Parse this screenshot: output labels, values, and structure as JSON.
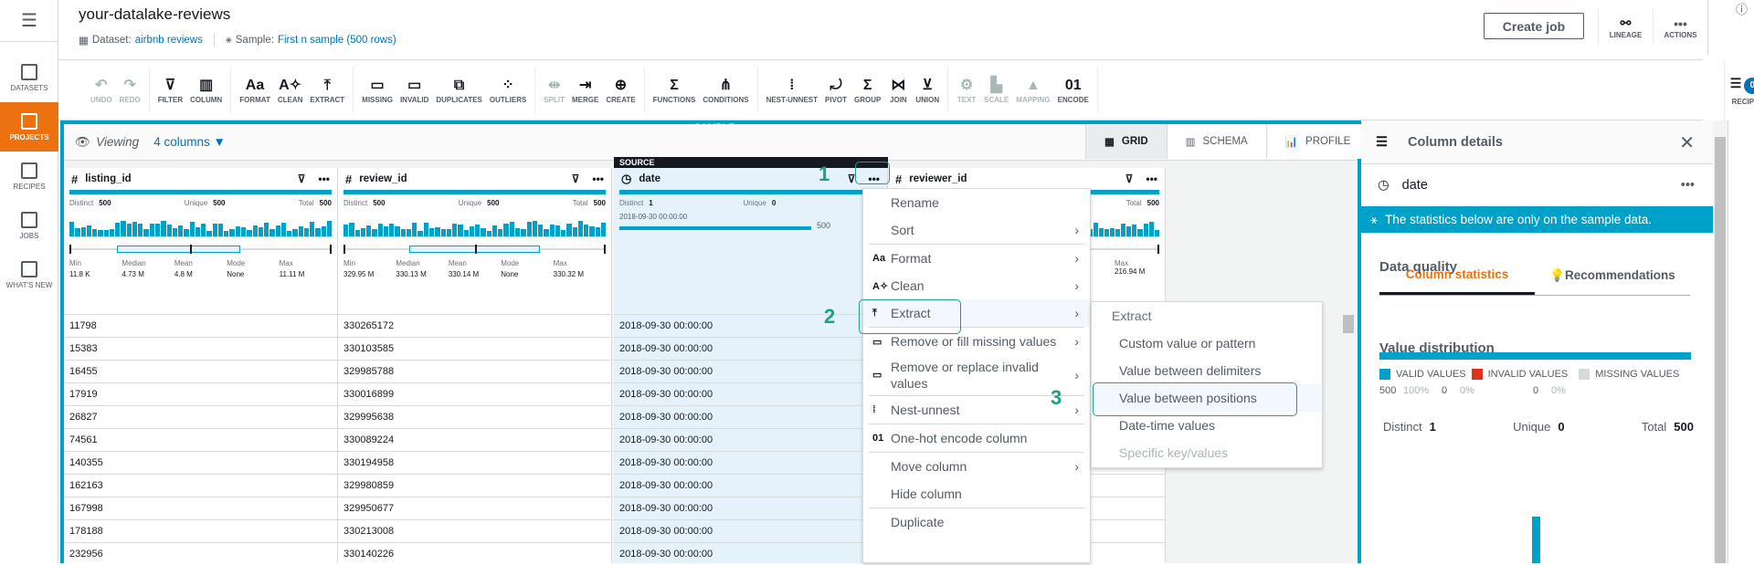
{
  "nav": {
    "items": [
      {
        "label": "DATASETS",
        "icon": "grid-icon",
        "active": false
      },
      {
        "label": "PROJECTS",
        "icon": "project-icon",
        "active": true
      },
      {
        "label": "RECIPES",
        "icon": "list-icon",
        "active": false
      },
      {
        "label": "JOBS",
        "icon": "play-icon",
        "active": false
      },
      {
        "label": "WHAT'S NEW",
        "icon": "news-icon",
        "active": false
      }
    ]
  },
  "header": {
    "title": "your-datalake-reviews",
    "dataset_prefix": "Dataset:",
    "dataset_link": "airbnb reviews",
    "sample_prefix": "Sample:",
    "sample_link": "First n sample (500 rows)",
    "create_job": "Create job",
    "lineage": "LINEAGE",
    "actions": "ACTIONS"
  },
  "toolbar": {
    "groups": [
      [
        {
          "label": "UNDO",
          "glyph": "↶",
          "disabled": true
        },
        {
          "label": "REDO",
          "glyph": "↷",
          "disabled": true
        }
      ],
      [
        {
          "label": "FILTER",
          "glyph": "⊽",
          "disabled": false
        },
        {
          "label": "COLUMN",
          "glyph": "▥",
          "disabled": false
        }
      ],
      [
        {
          "label": "FORMAT",
          "glyph": "Aa",
          "disabled": false
        },
        {
          "label": "CLEAN",
          "glyph": "A✧",
          "disabled": false
        },
        {
          "label": "EXTRACT",
          "glyph": "⤒",
          "disabled": false
        }
      ],
      [
        {
          "label": "MISSING",
          "glyph": "▭",
          "disabled": false
        },
        {
          "label": "INVALID",
          "glyph": "▭",
          "disabled": false
        },
        {
          "label": "DUPLICATES",
          "glyph": "⧉",
          "disabled": false
        },
        {
          "label": "OUTLIERS",
          "glyph": "⁘",
          "disabled": false
        }
      ],
      [
        {
          "label": "SPLIT",
          "glyph": "⇹",
          "disabled": true
        },
        {
          "label": "MERGE",
          "glyph": "⇥",
          "disabled": false
        },
        {
          "label": "CREATE",
          "glyph": "⊕",
          "disabled": false
        }
      ],
      [
        {
          "label": "FUNCTIONS",
          "glyph": "Σ",
          "disabled": false
        },
        {
          "label": "CONDITIONS",
          "glyph": "⋔",
          "disabled": false
        }
      ],
      [
        {
          "label": "NEST-UNNEST",
          "glyph": "⁞",
          "disabled": false
        },
        {
          "label": "PIVOT",
          "glyph": "⤾",
          "disabled": false
        },
        {
          "label": "GROUP",
          "glyph": "Σ",
          "disabled": false
        },
        {
          "label": "JOIN",
          "glyph": "⋈",
          "disabled": false
        },
        {
          "label": "UNION",
          "glyph": "⊻",
          "disabled": false
        }
      ],
      [
        {
          "label": "TEXT",
          "glyph": "⚙",
          "disabled": true
        },
        {
          "label": "SCALE",
          "glyph": "▙",
          "disabled": true
        },
        {
          "label": "MAPPING",
          "glyph": "▲",
          "disabled": true
        },
        {
          "label": "ENCODE",
          "glyph": "01",
          "disabled": false
        }
      ]
    ],
    "recipe_label": "RECIPE",
    "recipe_count": "0"
  },
  "grid": {
    "sample_badge": "SAMPLE",
    "viewing": "Viewing",
    "columns_selector": "4 columns",
    "rows": "500 rows",
    "view_tabs": [
      {
        "label": "GRID",
        "active": true
      },
      {
        "label": "SCHEMA",
        "active": false
      },
      {
        "label": "PROFILE",
        "active": false
      }
    ],
    "source_label": "SOURCE",
    "columns": [
      {
        "name": "listing_id",
        "type": "#",
        "distinct": "500",
        "unique": "500",
        "total": "500",
        "quartiles": [
          {
            "k": "Min",
            "v": "11.8 K"
          },
          {
            "k": "Median",
            "v": "4.73 M"
          },
          {
            "k": "Mean",
            "v": "4.8 M"
          },
          {
            "k": "Mode",
            "v": "None"
          },
          {
            "k": "Max",
            "v": "11.11 M"
          }
        ],
        "box": {
          "q1": 0.18,
          "median": 0.46,
          "q3": 0.65
        },
        "values": [
          "11798",
          "15383",
          "16455",
          "17919",
          "26827",
          "74561",
          "140355",
          "162163",
          "167998",
          "178188",
          "232956"
        ]
      },
      {
        "name": "review_id",
        "type": "#",
        "distinct": "500",
        "unique": "500",
        "total": "500",
        "quartiles": [
          {
            "k": "Min",
            "v": "329.95 M"
          },
          {
            "k": "Median",
            "v": "330.13 M"
          },
          {
            "k": "Mean",
            "v": "330.14 M"
          },
          {
            "k": "Mode",
            "v": "None"
          },
          {
            "k": "Max",
            "v": "330.32 M"
          }
        ],
        "box": {
          "q1": 0.25,
          "median": 0.5,
          "q3": 0.75
        },
        "values": [
          "330265172",
          "330103585",
          "329985788",
          "330016899",
          "329995638",
          "330089224",
          "330194958",
          "329980859",
          "329950677",
          "330213008",
          "330140226"
        ]
      },
      {
        "name": "date",
        "type": "clock",
        "distinct": "1",
        "unique": "0",
        "total": "",
        "top_value": "2018-09-30 00:00:00",
        "top_count": "500",
        "values": [
          "2018-09-30 00:00:00",
          "2018-09-30 00:00:00",
          "2018-09-30 00:00:00",
          "2018-09-30 00:00:00",
          "2018-09-30 00:00:00",
          "2018-09-30 00:00:00",
          "2018-09-30 00:00:00",
          "2018-09-30 00:00:00",
          "2018-09-30 00:00:00",
          "2018-09-30 00:00:00",
          "2018-09-30 00:00:00"
        ]
      },
      {
        "name": "reviewer_id",
        "type": "#",
        "total": "500",
        "max_label": "Max",
        "max": "216.94 M"
      }
    ]
  },
  "context_menu": {
    "items": [
      {
        "label": "Rename",
        "icon": "",
        "submenu": false
      },
      {
        "label": "Sort",
        "icon": "",
        "submenu": true,
        "sep_after": true
      },
      {
        "label": "Format",
        "icon": "Aa",
        "submenu": true
      },
      {
        "label": "Clean",
        "icon": "A✧",
        "submenu": true
      },
      {
        "label": "Extract",
        "icon": "⤒",
        "submenu": true,
        "highlight": true,
        "sep_after": true
      },
      {
        "label": "Remove or fill missing values",
        "icon": "▭",
        "submenu": true
      },
      {
        "label": "Remove or replace invalid values",
        "icon": "▭",
        "submenu": true,
        "two_line": true,
        "sep_after": true
      },
      {
        "label": "Nest-unnest",
        "icon": "⁞",
        "submenu": true,
        "sep_after": true
      },
      {
        "label": "One-hot encode column",
        "icon": "01",
        "submenu": false,
        "sep_after": true
      },
      {
        "label": "Move column",
        "icon": "",
        "submenu": true
      },
      {
        "label": "Hide column",
        "icon": "",
        "submenu": false,
        "sep_after": true
      },
      {
        "label": "Duplicate",
        "icon": "",
        "submenu": false
      }
    ],
    "submenu": {
      "header": "Extract",
      "items": [
        {
          "label": "Custom value or pattern",
          "disabled": false
        },
        {
          "label": "Value between delimiters",
          "disabled": false
        },
        {
          "label": "Value between positions",
          "disabled": false,
          "highlight": true
        },
        {
          "label": "Date-time values",
          "disabled": false
        },
        {
          "label": "Specific key/values",
          "disabled": true
        }
      ]
    },
    "step_markers": [
      "1",
      "2",
      "3"
    ]
  },
  "details_panel": {
    "title": "Column details",
    "column_name": "date",
    "note": "The statistics below are only on the sample data.",
    "tabs": [
      {
        "label": "Column statistics",
        "active": true
      },
      {
        "label": "Recommendations",
        "active": false
      }
    ],
    "data_quality_title": "Data quality",
    "legend": [
      {
        "label": "VALID VALUES",
        "count": "500",
        "pct": "100%",
        "color": "#00a1c9"
      },
      {
        "label": "INVALID VALUES",
        "count": "0",
        "pct": "0%",
        "color": "#e0301e"
      },
      {
        "label": "MISSING VALUES",
        "count": "0",
        "pct": "0%",
        "color": "#d5dbdb"
      }
    ],
    "valid_fraction": 1.0,
    "value_distribution_title": "Value distribution",
    "distinct_label": "Distinct",
    "distinct": "1",
    "unique_label": "Unique",
    "unique": "0",
    "total_label": "Total",
    "total": "500"
  }
}
